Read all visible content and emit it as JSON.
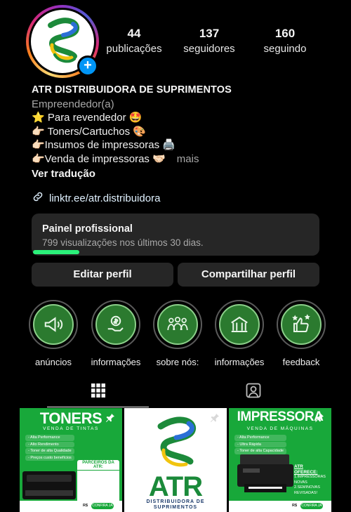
{
  "profile": {
    "stats": [
      {
        "value": "44",
        "label": "publicações"
      },
      {
        "value": "137",
        "label": "seguidores"
      },
      {
        "value": "160",
        "label": "seguindo"
      }
    ],
    "add_story_icon": "plus-icon",
    "name": "ATR DISTRIBUIDORA DE SUPRIMENTOS",
    "category": "Empreendedor(a)",
    "bio_lines": [
      "⭐ Para revendedor 🤩",
      "👉🏻 Toners/Cartuchos 🎨",
      "👉🏻Insumos de impressoras 🖨️",
      "👉🏻Venda de impressoras 🤝🏻"
    ],
    "more_label": "mais",
    "translate_label": "Ver tradução",
    "link": "linktr.ee/atr.distribuidora"
  },
  "panel": {
    "title": "Painel profissional",
    "subtitle": "799 visualizações nos últimos 30 dias."
  },
  "buttons": {
    "edit": "Editar perfil",
    "share": "Compartilhar perfil"
  },
  "highlights": [
    {
      "label": "anúncios",
      "icon": "megaphone-icon"
    },
    {
      "label": "informações",
      "icon": "money-hand-icon"
    },
    {
      "label": "sobre nós:",
      "icon": "team-icon"
    },
    {
      "label": "informações",
      "icon": "building-icon"
    },
    {
      "label": "feedback",
      "icon": "thumbs-up-stars-icon"
    }
  ],
  "tabs": {
    "grid_icon": "grid-icon",
    "tagged_icon": "tagged-person-icon"
  },
  "posts": {
    "p1": {
      "title": "TONERS",
      "subtitle": "VENDA DE TINTAS",
      "bullets": [
        "- Alta Performance",
        "- Alto Rendimento",
        "- Toner de alta Qualidade",
        "- Preços custo benefícios"
      ],
      "partners": "PARCEIROS DA ATR:",
      "price": "R$",
      "cta": "CONFIRA JÁ"
    },
    "p2": {
      "word": "ATR",
      "sub1": "DISTRIBUIDORA DE",
      "sub2": "SUPRIMENTOS"
    },
    "p3": {
      "title": "IMPRESSORA",
      "subtitle": "VENDA DE MÁQUINAS",
      "bullets": [
        "- Alta Performance",
        "- Ultra Rápida",
        "- Toner de alta Capacidade"
      ],
      "offers_title": "ATR OFERECE:",
      "offers": [
        "1.IMPRESSORAS NOVAS",
        "2.SEMINOVAS REVISADAS!"
      ],
      "price": "R$",
      "cta": "CONFIRA JÁ"
    }
  },
  "colors": {
    "background": "#000000",
    "surface": "#262626",
    "accent_green": "#2bf07a",
    "link": "#e0f1ff",
    "brand_green": "#18a83a",
    "story_blue": "#0095f6"
  }
}
